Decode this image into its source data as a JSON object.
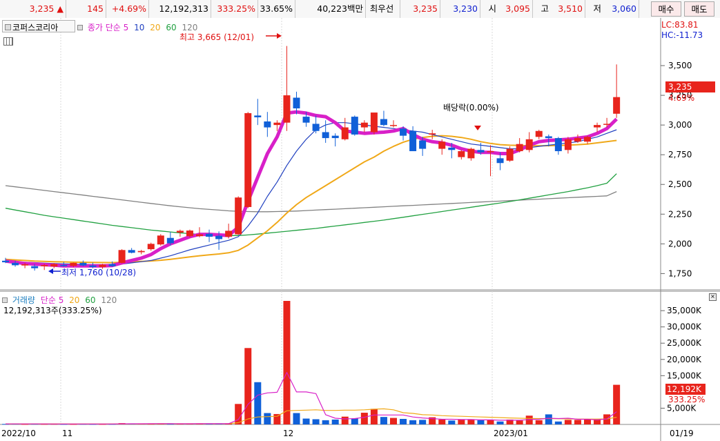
{
  "topbar": {
    "price": "3,235",
    "up_arrow": "▲",
    "change": "145",
    "change_pct": "+4.69%",
    "volume": "12,192,313",
    "volume_ratio": "333.25%",
    "turnover": "33.65%",
    "trade_value": "40,223백만",
    "best_label": "최우선",
    "ask": "3,235",
    "bid": "3,230",
    "open_label": "시",
    "open": "3,095",
    "high_label": "고",
    "high": "3,510",
    "low_label": "저",
    "low": "3,060",
    "buy_button": "매수",
    "sell_button": "매도"
  },
  "price_panel": {
    "stock_name": "코퍼스코리아",
    "ma_label": "종가 단순",
    "ma_periods": [
      "5",
      "10",
      "20",
      "60",
      "120"
    ],
    "lc": "LC:83.81",
    "hc": "HC:-11.73",
    "high_annotation": "최고 3,665 (12/01)",
    "low_annotation": "최저 1,760 (10/28)",
    "dividend_annotation": "배당락(0.00%)",
    "current_price_tag": "3,235",
    "current_change_tag": "4.69%",
    "y_ticks": [
      "3,500",
      "3,250",
      "3,000",
      "2,750",
      "2,500",
      "2,250",
      "2,000",
      "1,750"
    ]
  },
  "volume_panel": {
    "title": "거래량",
    "ma_label": "단순",
    "ma_periods": [
      "5",
      "20",
      "60",
      "120"
    ],
    "current_volume": "12,192,313주(333.25%)",
    "current_tag": "12,192K",
    "current_pct_tag": "333.25%",
    "y_ticks": [
      "35,000K",
      "30,000K",
      "25,000K",
      "20,000K",
      "15,000K",
      "5,000K"
    ]
  },
  "x_axis": {
    "labels": [
      "2022/10",
      "11",
      "12",
      "2023/01",
      "01/19"
    ]
  },
  "colors": {
    "up": "#e8241c",
    "down": "#1060d8",
    "ma5": "#d820c8",
    "ma10": "#2040c0",
    "ma20": "#f0a818",
    "ma60": "#20a040",
    "ma120": "#808080",
    "background": "#ffffff"
  },
  "chart_data": {
    "type": "candlestick",
    "x_labels": [
      "2022/10",
      "11",
      "12",
      "2023/01",
      "01/19"
    ],
    "ylim": [
      1700,
      3750
    ],
    "volume_ylim": [
      0,
      38000
    ],
    "candles": [
      [
        1858,
        1882,
        1838,
        1845
      ],
      [
        1840,
        1858,
        1808,
        1820
      ],
      [
        1818,
        1840,
        1795,
        1828
      ],
      [
        1812,
        1830,
        1775,
        1795
      ],
      [
        1812,
        1832,
        1780,
        1822
      ],
      [
        1810,
        1838,
        1795,
        1830
      ],
      [
        1822,
        1848,
        1808,
        1812
      ],
      [
        1815,
        1842,
        1802,
        1840
      ],
      [
        1840,
        1860,
        1812,
        1818
      ],
      [
        1818,
        1842,
        1795,
        1805
      ],
      [
        1805,
        1832,
        1790,
        1825
      ],
      [
        1830,
        1852,
        1808,
        1812
      ],
      [
        1840,
        1955,
        1835,
        1948
      ],
      [
        1948,
        1965,
        1920,
        1925
      ],
      [
        1930,
        1950,
        1912,
        1940
      ],
      [
        1955,
        2010,
        1942,
        2000
      ],
      [
        1995,
        2082,
        1985,
        2070
      ],
      [
        2050,
        2100,
        1985,
        2005
      ],
      [
        2095,
        2120,
        2060,
        2110
      ],
      [
        2065,
        2120,
        2055,
        2112
      ],
      [
        2065,
        2140,
        2055,
        2080
      ],
      [
        2085,
        2120,
        2015,
        2060
      ],
      [
        2068,
        2105,
        1950,
        2040
      ],
      [
        2060,
        2170,
        2045,
        2110
      ],
      [
        2080,
        2400,
        2075,
        2390
      ],
      [
        2310,
        3110,
        2300,
        3100
      ],
      [
        3080,
        3220,
        3000,
        3065
      ],
      [
        3030,
        3110,
        2900,
        2980
      ],
      [
        3000,
        3040,
        2950,
        3020
      ],
      [
        3020,
        3665,
        2950,
        3250
      ],
      [
        3230,
        3280,
        3090,
        3140
      ],
      [
        3070,
        3110,
        2985,
        3020
      ],
      [
        3010,
        3080,
        2930,
        2950
      ],
      [
        2940,
        3040,
        2850,
        2890
      ],
      [
        2910,
        2930,
        2820,
        2890
      ],
      [
        2880,
        3060,
        2870,
        2980
      ],
      [
        3070,
        3080,
        2910,
        2920
      ],
      [
        2980,
        3040,
        2940,
        3020
      ],
      [
        2940,
        3090,
        2920,
        3105
      ],
      [
        3050,
        3120,
        2990,
        3000
      ],
      [
        3000,
        3040,
        2980,
        3000
      ],
      [
        2970,
        2990,
        2870,
        2910
      ],
      [
        2950,
        2990,
        2850,
        2780
      ],
      [
        2870,
        2900,
        2740,
        2800
      ],
      [
        2920,
        2960,
        2880,
        2930
      ],
      [
        2800,
        2880,
        2750,
        2860
      ],
      [
        2810,
        2850,
        2720,
        2790
      ],
      [
        2730,
        2790,
        2710,
        2780
      ],
      [
        2720,
        2810,
        2700,
        2800
      ],
      [
        2790,
        2850,
        2750,
        2770
      ],
      [
        2780,
        2830,
        2570,
        2780
      ],
      [
        2720,
        2770,
        2620,
        2680
      ],
      [
        2700,
        2820,
        2690,
        2800
      ],
      [
        2780,
        2890,
        2770,
        2840
      ],
      [
        2790,
        2940,
        2770,
        2880
      ],
      [
        2900,
        2960,
        2880,
        2950
      ],
      [
        2905,
        2920,
        2820,
        2890
      ],
      [
        2890,
        2900,
        2750,
        2780
      ],
      [
        2790,
        2900,
        2760,
        2880
      ],
      [
        2860,
        2920,
        2850,
        2890
      ],
      [
        2860,
        2910,
        2840,
        2900
      ],
      [
        2980,
        3020,
        2940,
        3000
      ],
      [
        3010,
        3060,
        2980,
        3010
      ],
      [
        3095,
        3510,
        3060,
        3235
      ]
    ],
    "volume": [
      150,
      200,
      120,
      180,
      140,
      160,
      130,
      110,
      170,
      130,
      120,
      150,
      400,
      300,
      220,
      180,
      260,
      170,
      200,
      210,
      230,
      190,
      250,
      300,
      6300,
      23500,
      13000,
      3500,
      3200,
      38000,
      3500,
      1800,
      1600,
      1300,
      1500,
      2400,
      1800,
      3600,
      4800,
      2300,
      2000,
      1700,
      1300,
      1400,
      2200,
      1500,
      1200,
      1500,
      1600,
      1300,
      1400,
      900,
      1500,
      1200,
      2700,
      1300,
      3100,
      900,
      1400,
      1400,
      1500,
      1600,
      3100,
      12192
    ],
    "ma5_volume": [
      180,
      180,
      170,
      160,
      160,
      150,
      150,
      140,
      150,
      140,
      140,
      150,
      190,
      210,
      220,
      240,
      250,
      230,
      210,
      210,
      230,
      230,
      230,
      240,
      1500,
      6200,
      9000,
      9700,
      9900,
      16000,
      10000,
      10000,
      9500,
      3000,
      1900,
      1700,
      1800,
      2200,
      2900,
      2900,
      2900,
      2900,
      2300,
      2000,
      1800,
      1600,
      1600,
      1500,
      1500,
      1400,
      1400,
      1300,
      1300,
      1300,
      1500,
      1600,
      1900,
      1800,
      1900,
      1600,
      1600,
      1400,
      1700,
      3900
    ],
    "ma20_volume": [
      200,
      195,
      190,
      188,
      185,
      182,
      180,
      178,
      176,
      175,
      173,
      172,
      185,
      190,
      195,
      200,
      205,
      205,
      210,
      210,
      210,
      215,
      220,
      235,
      540,
      1700,
      2300,
      2400,
      2500,
      4200,
      4300,
      4400,
      4500,
      4300,
      4300,
      4400,
      4400,
      4500,
      4700,
      4800,
      4500,
      3600,
      3400,
      3000,
      2900,
      2700,
      2600,
      2500,
      2400,
      2300,
      2200,
      2100,
      2000,
      1900,
      1850,
      1800,
      1800,
      1750,
      1700,
      1650,
      1650,
      1650,
      1700,
      2200
    ],
    "price_ma5": [
      1855,
      1845,
      1835,
      1830,
      1825,
      1820,
      1815,
      1815,
      1815,
      1815,
      1815,
      1818,
      1840,
      1860,
      1880,
      1910,
      1960,
      2000,
      2030,
      2060,
      2080,
      2080,
      2075,
      2070,
      2140,
      2360,
      2560,
      2760,
      2900,
      3100,
      3110,
      3100,
      3080,
      3070,
      3020,
      2950,
      2940,
      2930,
      2935,
      2940,
      2950,
      2970,
      2920,
      2880,
      2860,
      2850,
      2830,
      2800,
      2780,
      2770,
      2770,
      2760,
      2760,
      2790,
      2830,
      2860,
      2870,
      2875,
      2880,
      2890,
      2900,
      2930,
      2970,
      3050
    ],
    "price_ma10": [
      1850,
      1848,
      1845,
      1842,
      1838,
      1835,
      1832,
      1830,
      1828,
      1826,
      1825,
      1824,
      1830,
      1840,
      1850,
      1860,
      1880,
      1900,
      1925,
      1950,
      1970,
      1990,
      2010,
      2030,
      2060,
      2150,
      2260,
      2400,
      2520,
      2660,
      2780,
      2880,
      2960,
      3000,
      3020,
      3020,
      3010,
      3000,
      2990,
      2980,
      2970,
      2960,
      2950,
      2940,
      2920,
      2900,
      2880,
      2860,
      2840,
      2830,
      2820,
      2810,
      2800,
      2800,
      2810,
      2820,
      2830,
      2840,
      2850,
      2860,
      2880,
      2900,
      2930,
      2960
    ],
    "price_ma20": [
      1870,
      1865,
      1860,
      1855,
      1852,
      1850,
      1848,
      1846,
      1845,
      1844,
      1843,
      1842,
      1845,
      1848,
      1852,
      1856,
      1862,
      1870,
      1880,
      1890,
      1900,
      1908,
      1915,
      1925,
      1945,
      1990,
      2050,
      2110,
      2180,
      2260,
      2330,
      2390,
      2440,
      2490,
      2540,
      2590,
      2640,
      2690,
      2730,
      2780,
      2820,
      2855,
      2880,
      2895,
      2905,
      2910,
      2905,
      2895,
      2880,
      2860,
      2845,
      2835,
      2830,
      2828,
      2826,
      2825,
      2826,
      2828,
      2830,
      2835,
      2840,
      2850,
      2860,
      2870
    ],
    "price_ma60": [
      2300,
      2285,
      2270,
      2255,
      2240,
      2228,
      2216,
      2204,
      2192,
      2180,
      2168,
      2156,
      2146,
      2136,
      2126,
      2116,
      2108,
      2100,
      2092,
      2086,
      2080,
      2076,
      2072,
      2070,
      2070,
      2075,
      2082,
      2090,
      2098,
      2106,
      2114,
      2122,
      2130,
      2140,
      2150,
      2160,
      2170,
      2180,
      2190,
      2200,
      2212,
      2224,
      2236,
      2248,
      2260,
      2272,
      2284,
      2296,
      2308,
      2320,
      2332,
      2344,
      2356,
      2370,
      2384,
      2398,
      2412,
      2426,
      2440,
      2456,
      2472,
      2490,
      2510,
      2590
    ],
    "price_ma120": [
      2490,
      2480,
      2470,
      2460,
      2450,
      2440,
      2430,
      2420,
      2410,
      2400,
      2390,
      2380,
      2370,
      2360,
      2350,
      2340,
      2330,
      2320,
      2312,
      2304,
      2296,
      2290,
      2284,
      2278,
      2274,
      2272,
      2270,
      2270,
      2272,
      2274,
      2276,
      2280,
      2284,
      2288,
      2292,
      2296,
      2300,
      2304,
      2308,
      2312,
      2316,
      2320,
      2324,
      2328,
      2332,
      2336,
      2340,
      2344,
      2348,
      2352,
      2356,
      2360,
      2364,
      2368,
      2372,
      2376,
      2380,
      2384,
      2388,
      2392,
      2396,
      2400,
      2404,
      2440
    ]
  }
}
